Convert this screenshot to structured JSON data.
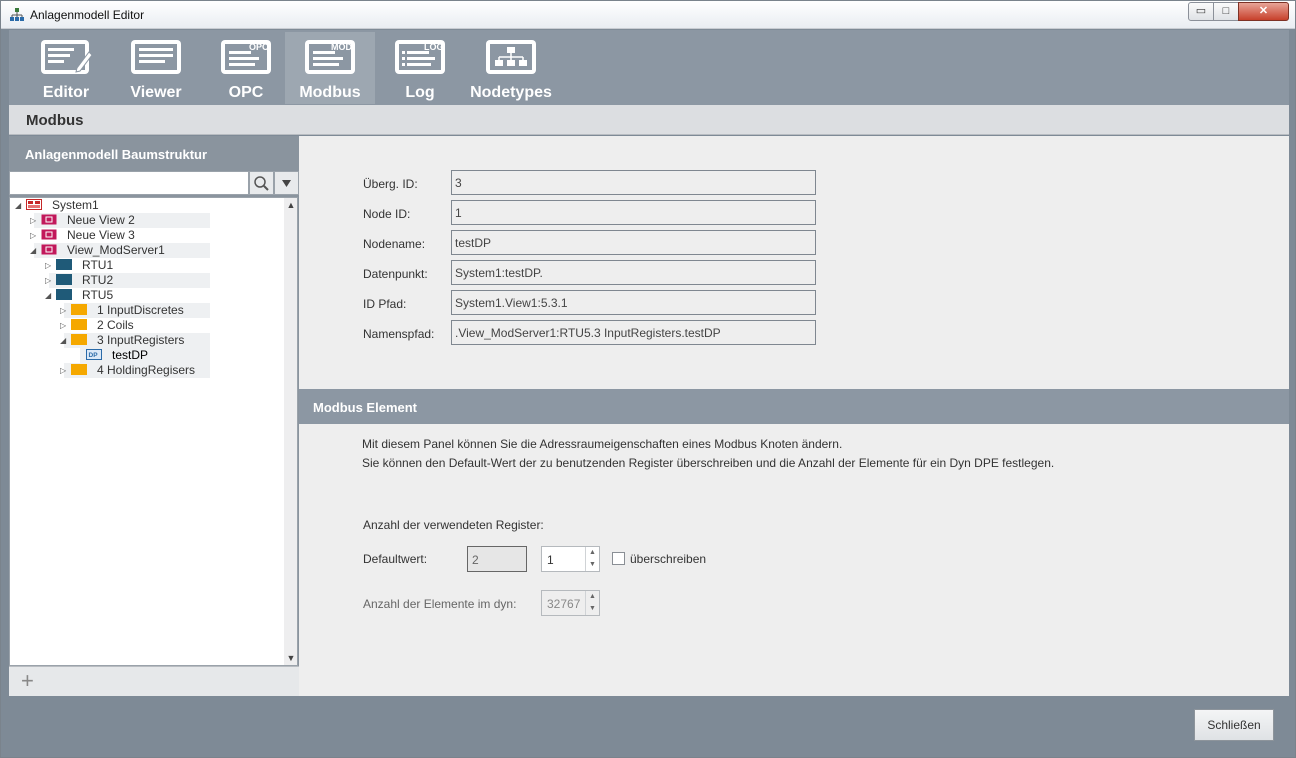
{
  "window": {
    "title": "Anlagenmodell Editor",
    "min": "▭",
    "max": "□",
    "close": "✕"
  },
  "toolbar": {
    "items": [
      {
        "label": "Editor",
        "icon": "editor-icon",
        "badge": ""
      },
      {
        "label": "Viewer",
        "icon": "viewer-icon",
        "badge": ""
      },
      {
        "label": "OPC",
        "icon": "opc-icon",
        "badge": "OPC"
      },
      {
        "label": "Modbus",
        "icon": "modbus-icon",
        "badge": "MOD"
      },
      {
        "label": "Log",
        "icon": "log-icon",
        "badge": "LOG"
      },
      {
        "label": "Nodetypes",
        "icon": "nodetypes-icon",
        "badge": ""
      }
    ],
    "active": "Modbus"
  },
  "section": {
    "title": "Modbus"
  },
  "tree_panel": {
    "title": "Anlagenmodell Baumstruktur",
    "search": {
      "value": "",
      "placeholder": ""
    },
    "nodes": [
      {
        "label": "System1",
        "expanded": true
      },
      {
        "label": "Neue View 2",
        "expanded": false
      },
      {
        "label": "Neue View 3",
        "expanded": false
      },
      {
        "label": "View_ModServer1",
        "expanded": true
      },
      {
        "label": "RTU1",
        "expanded": false
      },
      {
        "label": "RTU2",
        "expanded": false
      },
      {
        "label": "RTU5",
        "expanded": true
      },
      {
        "label": "1 InputDiscretes",
        "expanded": false
      },
      {
        "label": "2 Coils",
        "expanded": false
      },
      {
        "label": "3 InputRegisters",
        "expanded": true
      },
      {
        "label": "testDP",
        "badge": "DP"
      },
      {
        "label": "4 HoldingRegisers",
        "expanded": false
      }
    ]
  },
  "form": {
    "fields": [
      {
        "label": "Überg. ID:",
        "value": "3"
      },
      {
        "label": "Node ID:",
        "value": "1"
      },
      {
        "label": "Nodename:",
        "value": "testDP"
      },
      {
        "label": "Datenpunkt:",
        "value": "System1:testDP."
      },
      {
        "label": "ID Pfad:",
        "value": "System1.View1:5.3.1"
      },
      {
        "label": "Namenspfad:",
        "value": ".View_ModServer1:RTU5.3 InputRegisters.testDP"
      }
    ]
  },
  "modbus_element": {
    "title": "Modbus Element",
    "desc_line1": "Mit diesem Panel können Sie die Adressraumeigenschaften eines Modbus Knoten ändern.",
    "desc_line2": "Sie können den Default-Wert der zu benutzenden Register überschreiben und die Anzahl der Elemente für ein Dyn DPE festlegen.",
    "register_caption": "Anzahl der verwendeten Register:",
    "default_label": "Defaultwert:",
    "default_value": "2",
    "override_value": "1",
    "override_label": "überschreiben",
    "override_checked": false,
    "dyn_label": "Anzahl der Elemente im dyn:",
    "dyn_value": "32767"
  },
  "footer": {
    "close_label": "Schließen"
  },
  "colors": {
    "toolbar": "#8c97a3",
    "window_bg": "#7e8a96",
    "content_bg": "#eeeeee",
    "folder": "#f5a800",
    "rtu": "#1f5a78",
    "view": "#c2185b"
  }
}
